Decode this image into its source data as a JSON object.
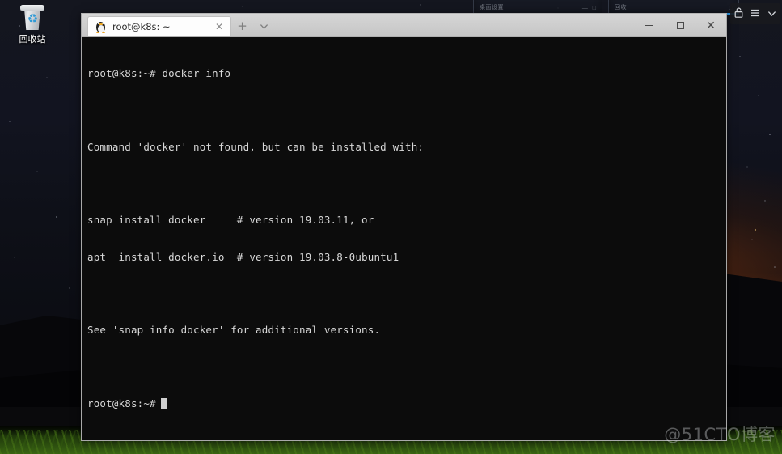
{
  "desktop": {
    "icons": [
      {
        "name": "recycle-bin",
        "label": "回收站",
        "icon": "recycle-bin-icon",
        "glyph": "♻"
      }
    ],
    "wallpaper_colors": {
      "sky_top": "#14161f",
      "sky_bottom": "#0b0c12",
      "horizon_glow": "#c45612",
      "ridge": "#07070a",
      "grass": "#3e6a14"
    }
  },
  "background_windows": [
    {
      "name": "background-window-left",
      "tiny_text": "桌面设置",
      "controls": "— □"
    },
    {
      "name": "background-window-right",
      "tiny_text": "回收",
      "controls": "□"
    }
  ],
  "mini_toolbar": {
    "buttons": [
      {
        "name": "lock-icon",
        "glyph": "🔓"
      },
      {
        "name": "hamburger-menu-icon",
        "glyph": "≡"
      },
      {
        "name": "chevron-down-icon",
        "glyph": "⌄"
      }
    ]
  },
  "terminal": {
    "tab": {
      "icon": "tux-linux-icon",
      "label": "root@k8s: ~",
      "close_glyph": "✕"
    },
    "new_tab_glyph": "+",
    "tab_dropdown_glyph": "⌄",
    "window_controls": {
      "minimize_label": "—",
      "maximize_label": "□",
      "close_label": "✕"
    },
    "colors": {
      "titlebar": "#cdcdcd",
      "tab_active": "#fdfdfd",
      "body_background": "#0c0c0c",
      "text": "#d8d8d8"
    },
    "lines": [
      "root@k8s:~# docker info",
      "",
      "Command 'docker' not found, but can be installed with:",
      "",
      "snap install docker     # version 19.03.11, or",
      "apt  install docker.io  # version 19.03.8-0ubuntu1",
      "",
      "See 'snap info docker' for additional versions.",
      ""
    ],
    "prompt": "root@k8s:~#",
    "cursor_visible": true
  },
  "watermark": {
    "text": "@51CTO博客"
  }
}
